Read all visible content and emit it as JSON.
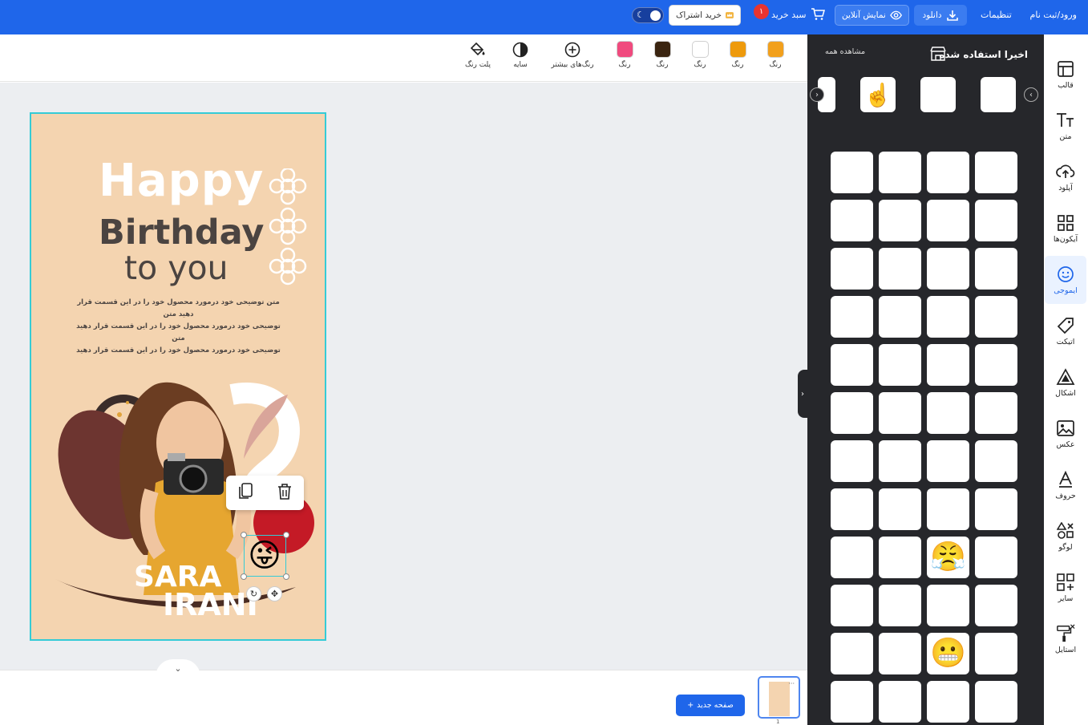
{
  "topbar": {
    "login": "ورود/ثبت نام",
    "settings": "تنظیمات",
    "download": "دانلود",
    "online_preview": "نمایش آنلاین",
    "cart": "سبد خرید",
    "cart_count": "۱",
    "buy_subscription": "خرید اشتراک"
  },
  "toolbar": {
    "items": [
      {
        "label": "رنگ",
        "color": "#f2a01c"
      },
      {
        "label": "رنگ",
        "color": "#ee9a0c"
      },
      {
        "label": "رنگ",
        "color": "#ffffff"
      },
      {
        "label": "رنگ",
        "color": "#3a2410"
      },
      {
        "label": "رنگ",
        "color": "#f04a7e"
      },
      {
        "label": "رنگ‌های بیشتر",
        "icon": "plus-circle-icon"
      },
      {
        "label": "سایه",
        "icon": "contrast-icon"
      },
      {
        "label": "پلت رنگ",
        "icon": "paint-bucket-icon"
      }
    ]
  },
  "design": {
    "happy": "Happy",
    "birthday": "Birthday",
    "to_you": "to you",
    "desc_lines": [
      "متن توضیحی خود درمورد محصول خود را در این قسمت قرار دهید متن",
      "توضیحی خود درمورد محصول خود را در این قسمت قرار دهید متن",
      "توضیحی خود درمورد محصول خود را در این قسمت قرار دهید"
    ],
    "name_first": "SARA",
    "name_last": "IRANI",
    "selected_emoji": "😜"
  },
  "pages": {
    "new_page": "صفحه جدید",
    "page_number": "1"
  },
  "panel": {
    "title": "اخیرا استفاده شده",
    "see_all": "مشاهده همه",
    "recent": [
      "😜",
      "😍",
      "☝️",
      "😏"
    ],
    "emojis": [
      "😅",
      "😁",
      "😀",
      "😃",
      "😄",
      "😂",
      "😉",
      "😇",
      "😆",
      "😍",
      "😌",
      "😋",
      "😊",
      "😘",
      "😑",
      "😐",
      "😏",
      "😎",
      "😒",
      "😓",
      "😔",
      "😕",
      "😙",
      "😗",
      "😖",
      "😝",
      "😜",
      "😛",
      "😚",
      "😡",
      "😠",
      "😟",
      "😞",
      "😤",
      "😥",
      "😣",
      "😢",
      "😦",
      "😧",
      "😨",
      "😩",
      "😬",
      "😫",
      "😪",
      "😮",
      "😯",
      "😮",
      "😰"
    ]
  },
  "rail": {
    "items": [
      {
        "label": "قالب",
        "icon": "template-icon"
      },
      {
        "label": "متن",
        "icon": "text-icon"
      },
      {
        "label": "آپلود",
        "icon": "upload-icon"
      },
      {
        "label": "آیکون‌ها",
        "icon": "grid-icon"
      },
      {
        "label": "ایموجی",
        "icon": "emoji-icon"
      },
      {
        "label": "اتیکت",
        "icon": "tag-icon"
      },
      {
        "label": "اشکال",
        "icon": "shapes-icon"
      },
      {
        "label": "عکس",
        "icon": "image-icon"
      },
      {
        "label": "حروف",
        "icon": "letter-icon"
      },
      {
        "label": "لوگو",
        "icon": "logo-icon"
      },
      {
        "label": "سایر",
        "icon": "more-icon"
      },
      {
        "label": "استایل",
        "icon": "paint-roller-icon"
      }
    ]
  }
}
